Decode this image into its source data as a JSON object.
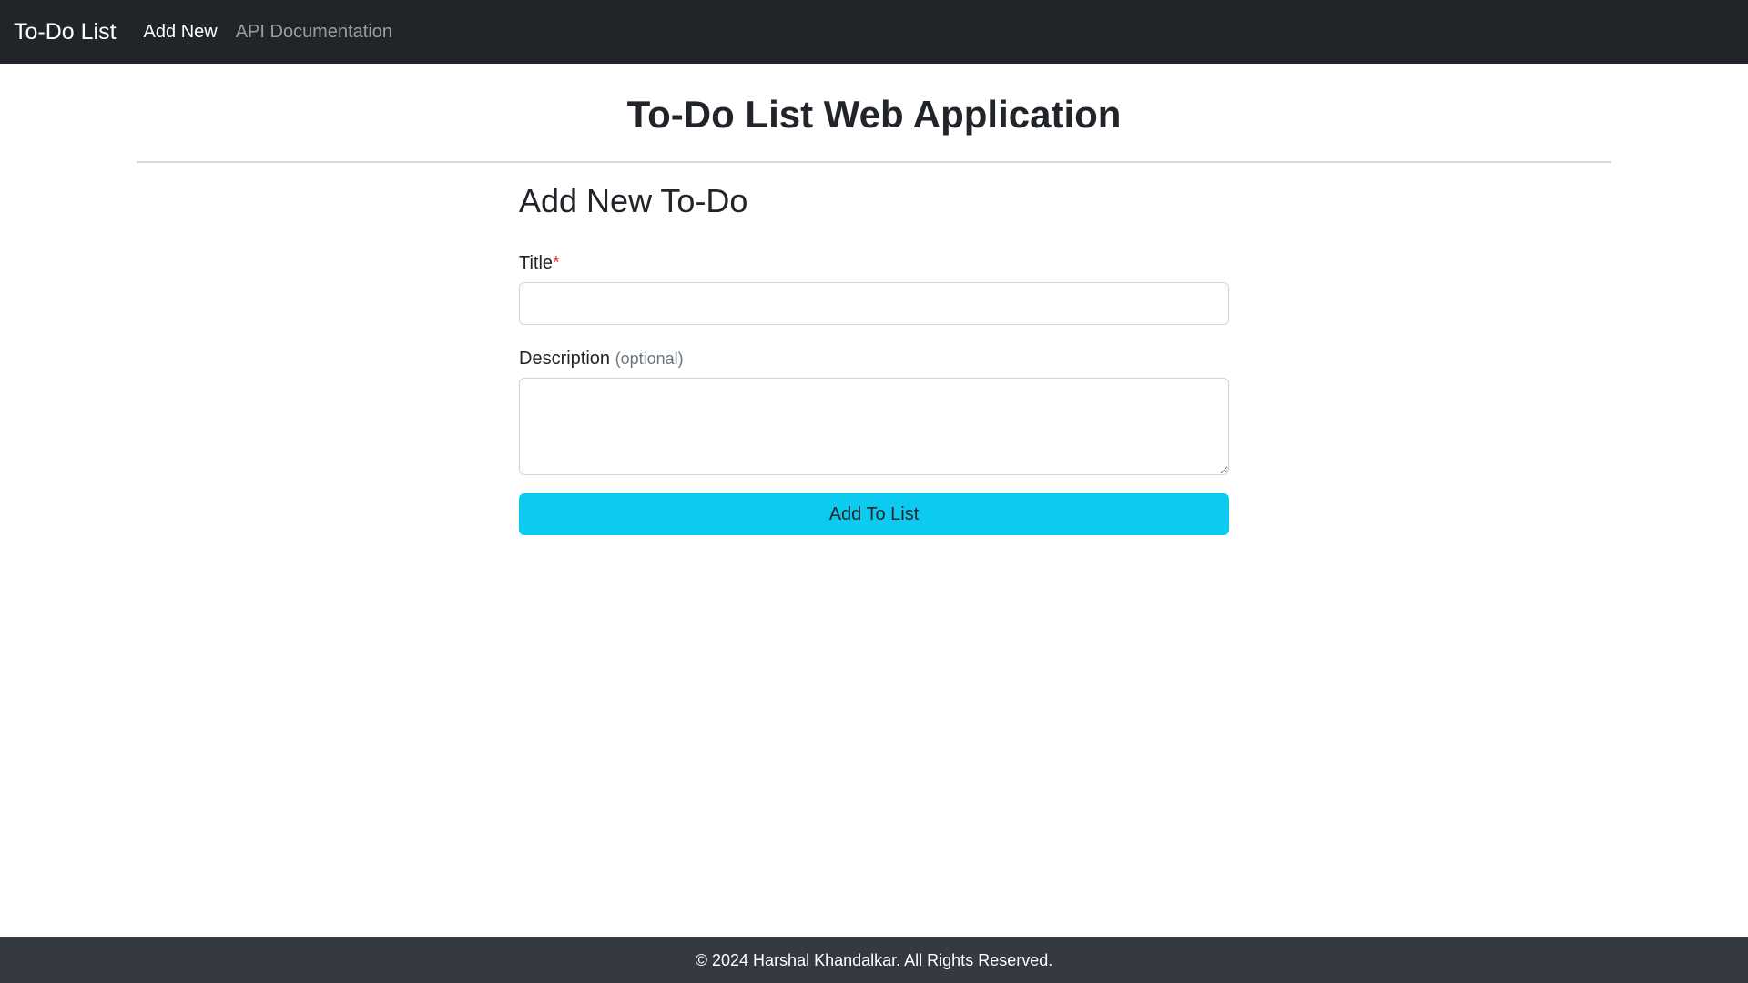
{
  "navbar": {
    "brand": "To-Do List",
    "links": [
      {
        "label": "Add New"
      },
      {
        "label": "API Documentation"
      }
    ]
  },
  "page": {
    "title": "To-Do List Web Application"
  },
  "form": {
    "heading": "Add New To-Do",
    "title_label": "Title",
    "required_mark": "*",
    "title_value": "",
    "description_label": "Description",
    "description_hint": "(optional)",
    "description_value": "",
    "submit_label": "Add To List"
  },
  "footer": {
    "text": "© 2024 Harshal Khandalkar. All Rights Reserved."
  },
  "colors": {
    "navbar_bg": "#212529",
    "footer_bg": "#343a40",
    "submit_bg": "#0dcaf0",
    "required": "#dc3545"
  }
}
